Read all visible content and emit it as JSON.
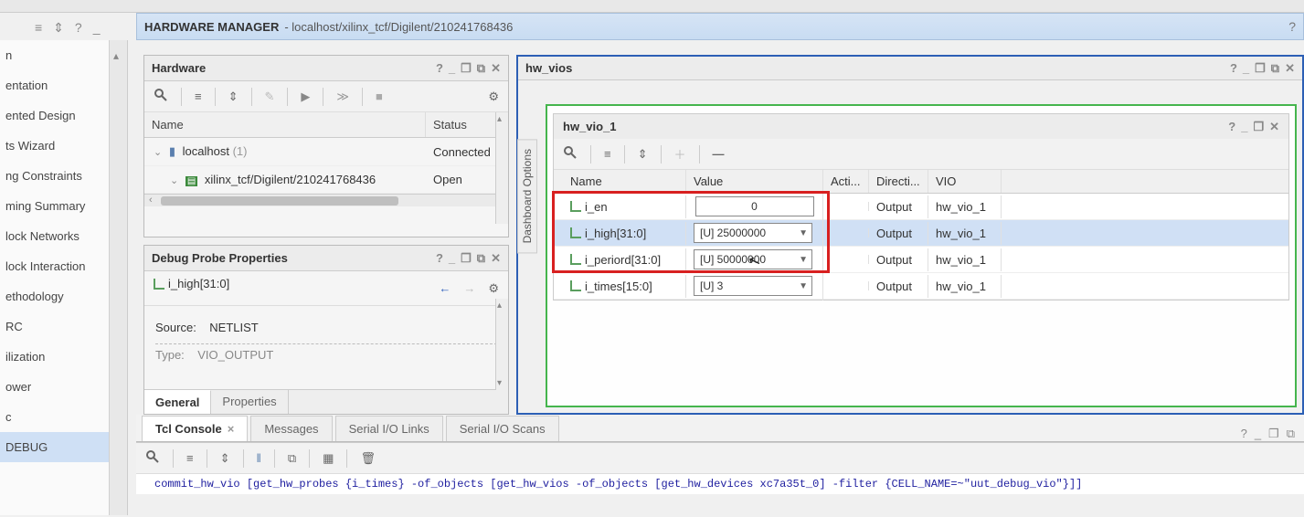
{
  "header": {
    "title": "HARDWARE MANAGER",
    "path": "- localhost/xilinx_tcf/Digilent/210241768436"
  },
  "left_nav": {
    "items": [
      "n",
      "entation",
      "ented Design",
      "ts Wizard",
      "ng Constraints",
      "ming Summary",
      "lock Networks",
      "lock Interaction",
      "ethodology",
      "RC",
      "ilization",
      "ower",
      "c",
      "DEBUG"
    ],
    "selected_index": 13
  },
  "hardware_panel": {
    "title": "Hardware",
    "columns": {
      "name": "Name",
      "status": "Status"
    },
    "rows": [
      {
        "indent": 1,
        "icon": "host",
        "label_prefix": "localhost",
        "count": "(1)",
        "status": "Connected"
      },
      {
        "indent": 2,
        "icon": "device",
        "label": "xilinx_tcf/Digilent/210241768436",
        "status": "Open"
      }
    ]
  },
  "debug_panel": {
    "title": "Debug Probe Properties",
    "signal": "i_high[31:0]",
    "source_label": "Source:",
    "source_value": "NETLIST",
    "type_label": "Type:",
    "type_value": "VIO_OUTPUT",
    "tabs": {
      "general": "General",
      "properties": "Properties"
    }
  },
  "vio": {
    "outer_title": "hw_vios",
    "dashboard_tab": "Dashboard Options",
    "inner_title": "hw_vio_1",
    "columns": {
      "name": "Name",
      "value": "Value",
      "activity": "Acti...",
      "direction": "Directi...",
      "vio": "VIO"
    },
    "rows": [
      {
        "name": "i_en",
        "value": "0",
        "value_style": "box",
        "direction": "Output",
        "vio": "hw_vio_1",
        "selected": false
      },
      {
        "name": "i_high[31:0]",
        "value": "[U] 25000000",
        "value_style": "combo",
        "direction": "Output",
        "vio": "hw_vio_1",
        "selected": true
      },
      {
        "name": "i_periord[31:0]",
        "value": "[U] 50000000",
        "value_style": "combo",
        "direction": "Output",
        "vio": "hw_vio_1",
        "selected": false
      },
      {
        "name": "i_times[15:0]",
        "value": "[U] 3",
        "value_style": "combo",
        "direction": "Output",
        "vio": "hw_vio_1",
        "selected": false
      }
    ]
  },
  "bottom": {
    "tabs": {
      "tcl": "Tcl Console",
      "messages": "Messages",
      "serial_links": "Serial I/O Links",
      "serial_scans": "Serial I/O Scans"
    },
    "console_line": "commit_hw_vio [get_hw_probes {i_times} -of_objects [get_hw_vios -of_objects [get_hw_devices xc7a35t_0] -filter {CELL_NAME=~\"uut_debug_vio\"}]]"
  },
  "icons": {
    "help": "?",
    "minimize": "_",
    "maximize": "❐",
    "popout": "⧉",
    "close": "✕",
    "search": "🔍",
    "collapse": "≡",
    "expand": "⇕",
    "gear": "⚙",
    "play": "▶",
    "step": "≫",
    "stop": "■",
    "plus": "＋",
    "minus": "—",
    "back": "←",
    "forward": "→",
    "pause": "‖",
    "copy": "⧉",
    "table": "▦",
    "trash": "🗑"
  }
}
